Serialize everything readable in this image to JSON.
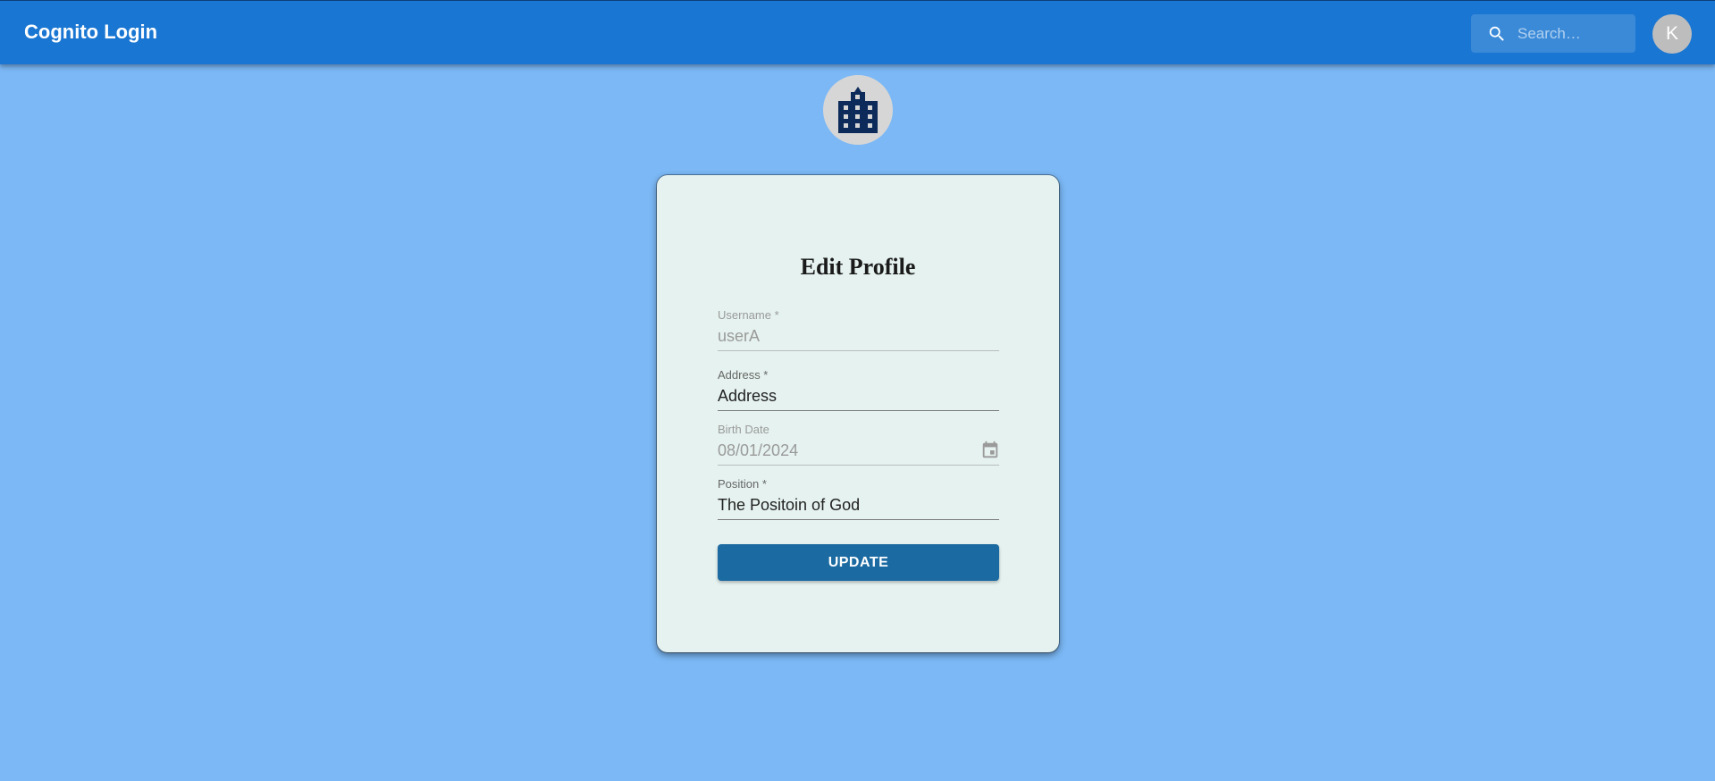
{
  "appbar": {
    "title": "Cognito Login",
    "search": {
      "placeholder": "Search…",
      "icon": "search-icon"
    },
    "avatar_initial": "K"
  },
  "logo": {
    "icon": "building-icon"
  },
  "form": {
    "title": "Edit Profile",
    "fields": [
      {
        "label": "Username *",
        "value": "userA",
        "disabled": true
      },
      {
        "label": "Address *",
        "value": "Address",
        "disabled": false
      },
      {
        "label": "Birth Date",
        "value": "08/01/2024",
        "disabled": true,
        "icon": "calendar-icon"
      },
      {
        "label": "Position *",
        "value": "The Positoin of God",
        "disabled": false
      }
    ],
    "submit_label": "UPDATE"
  },
  "colors": {
    "appbar": "#1976d2",
    "background": "#7bb8f5",
    "card": "#e5f2ef",
    "button": "#1b6aa1",
    "logo_icon": "#0d2b5a"
  }
}
